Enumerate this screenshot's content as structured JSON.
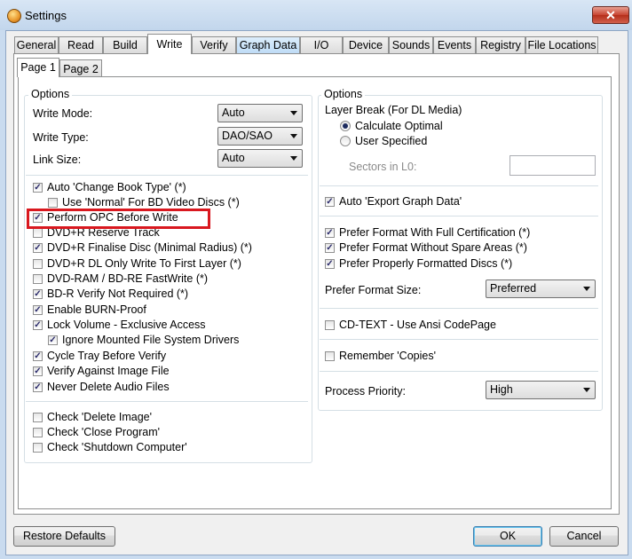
{
  "window": {
    "title": "Settings",
    "close_glyph": "✕"
  },
  "tabs": [
    "General",
    "Read",
    "Build",
    "Write",
    "Verify",
    "Graph Data",
    "I/O",
    "Device",
    "Sounds",
    "Events",
    "Registry",
    "File Locations"
  ],
  "subtabs": [
    "Page 1",
    "Page 2"
  ],
  "left": {
    "group_title": "Options",
    "write_mode": {
      "label": "Write Mode:",
      "value": "Auto"
    },
    "write_type": {
      "label": "Write Type:",
      "value": "DAO/SAO"
    },
    "link_size": {
      "label": "Link Size:",
      "value": "Auto"
    },
    "checks": [
      {
        "label": "Auto 'Change Book Type' (*)",
        "checked": true
      },
      {
        "label": "Use 'Normal' For BD Video Discs (*)",
        "checked": false
      },
      {
        "label": "Perform OPC Before Write",
        "checked": true
      },
      {
        "label": "DVD+R Reserve Track",
        "checked": false
      },
      {
        "label": "DVD+R Finalise Disc (Minimal Radius) (*)",
        "checked": true
      },
      {
        "label": "DVD+R DL Only Write To First Layer (*)",
        "checked": false
      },
      {
        "label": "DVD-RAM / BD-RE FastWrite (*)",
        "checked": false
      },
      {
        "label": "BD-R Verify Not Required (*)",
        "checked": true
      },
      {
        "label": "Enable BURN-Proof",
        "checked": true
      },
      {
        "label": "Lock Volume - Exclusive Access",
        "checked": true
      },
      {
        "label": "Ignore Mounted File System Drivers",
        "checked": true
      },
      {
        "label": "Cycle Tray Before Verify",
        "checked": true
      },
      {
        "label": "Verify Against Image File",
        "checked": true
      },
      {
        "label": "Never Delete Audio Files",
        "checked": true
      },
      {
        "label": "Check 'Delete Image'",
        "checked": false
      },
      {
        "label": "Check 'Close Program'",
        "checked": false
      },
      {
        "label": "Check 'Shutdown Computer'",
        "checked": false
      }
    ]
  },
  "right": {
    "group_title": "Options",
    "layer_break_label": "Layer Break (For DL Media)",
    "radio_calc": "Calculate Optimal",
    "radio_user": "User Specified",
    "sectors_label": "Sectors in L0:",
    "sectors_value": "",
    "checks": [
      {
        "label": "Auto 'Export Graph Data'",
        "checked": true
      },
      {
        "label": "Prefer Format With Full Certification (*)",
        "checked": true
      },
      {
        "label": "Prefer Format Without Spare Areas (*)",
        "checked": true
      },
      {
        "label": "Prefer Properly Formatted Discs (*)",
        "checked": true
      },
      {
        "label": "CD-TEXT - Use Ansi CodePage",
        "checked": false
      },
      {
        "label": "Remember 'Copies'",
        "checked": false
      }
    ],
    "format_size": {
      "label": "Prefer Format Size:",
      "value": "Preferred"
    },
    "priority": {
      "label": "Process Priority:",
      "value": "High"
    }
  },
  "buttons": {
    "restore": "Restore Defaults",
    "ok": "OK",
    "cancel": "Cancel"
  },
  "check_glyph": "✓",
  "colors": {
    "highlight": "#d9181f",
    "close": "#c7432f",
    "accent_tab": "#bfdcf6"
  }
}
